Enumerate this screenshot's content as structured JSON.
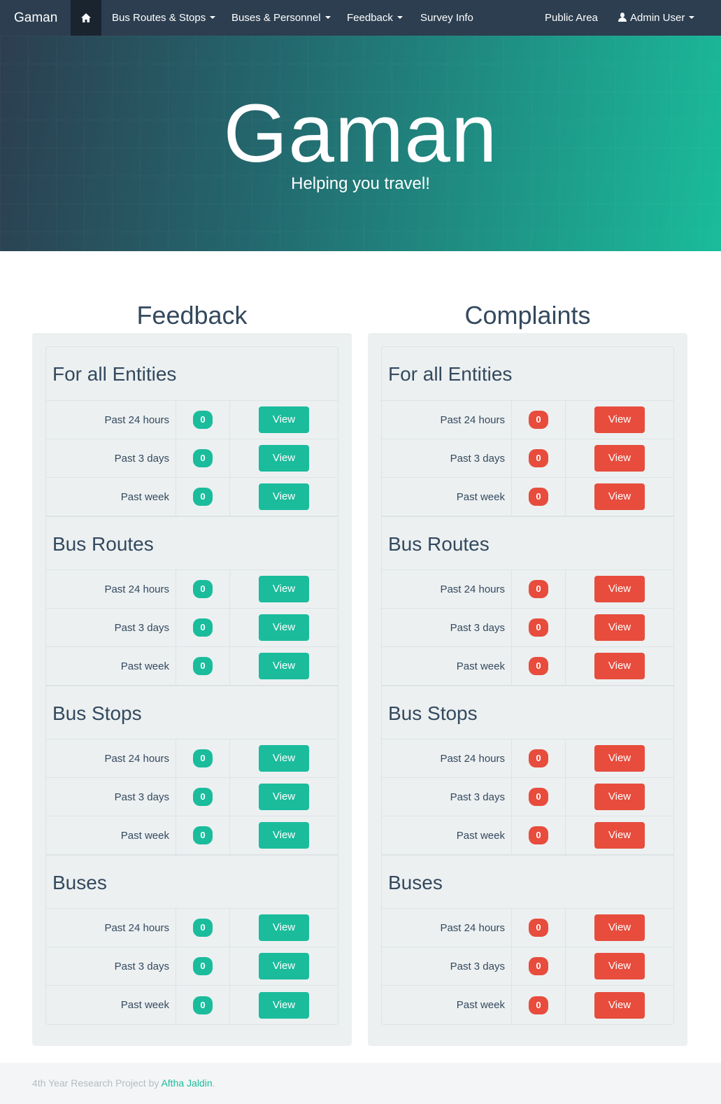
{
  "nav": {
    "brand": "Gaman",
    "items": [
      {
        "label": "Bus Routes & Stops",
        "dropdown": true
      },
      {
        "label": "Buses & Personnel",
        "dropdown": true
      },
      {
        "label": "Feedback",
        "dropdown": true
      },
      {
        "label": "Survey Info",
        "dropdown": false
      }
    ],
    "public_area": "Public Area",
    "user": "Admin User"
  },
  "hero": {
    "title": "Gaman",
    "subtitle": "Helping you travel!"
  },
  "columns": [
    {
      "title": "Feedback",
      "color": "#1abc9c",
      "sections": [
        {
          "heading": "For all Entities",
          "rows": [
            {
              "label": "Past 24 hours",
              "count": "0",
              "button": "View"
            },
            {
              "label": "Past 3 days",
              "count": "0",
              "button": "View"
            },
            {
              "label": "Past week",
              "count": "0",
              "button": "View"
            }
          ]
        },
        {
          "heading": "Bus Routes",
          "rows": [
            {
              "label": "Past 24 hours",
              "count": "0",
              "button": "View"
            },
            {
              "label": "Past 3 days",
              "count": "0",
              "button": "View"
            },
            {
              "label": "Past week",
              "count": "0",
              "button": "View"
            }
          ]
        },
        {
          "heading": "Bus Stops",
          "rows": [
            {
              "label": "Past 24 hours",
              "count": "0",
              "button": "View"
            },
            {
              "label": "Past 3 days",
              "count": "0",
              "button": "View"
            },
            {
              "label": "Past week",
              "count": "0",
              "button": "View"
            }
          ]
        },
        {
          "heading": "Buses",
          "rows": [
            {
              "label": "Past 24 hours",
              "count": "0",
              "button": "View"
            },
            {
              "label": "Past 3 days",
              "count": "0",
              "button": "View"
            },
            {
              "label": "Past week",
              "count": "0",
              "button": "View"
            }
          ]
        }
      ]
    },
    {
      "title": "Complaints",
      "color": "#e74c3c",
      "sections": [
        {
          "heading": "For all Entities",
          "rows": [
            {
              "label": "Past 24 hours",
              "count": "0",
              "button": "View"
            },
            {
              "label": "Past 3 days",
              "count": "0",
              "button": "View"
            },
            {
              "label": "Past week",
              "count": "0",
              "button": "View"
            }
          ]
        },
        {
          "heading": "Bus Routes",
          "rows": [
            {
              "label": "Past 24 hours",
              "count": "0",
              "button": "View"
            },
            {
              "label": "Past 3 days",
              "count": "0",
              "button": "View"
            },
            {
              "label": "Past week",
              "count": "0",
              "button": "View"
            }
          ]
        },
        {
          "heading": "Bus Stops",
          "rows": [
            {
              "label": "Past 24 hours",
              "count": "0",
              "button": "View"
            },
            {
              "label": "Past 3 days",
              "count": "0",
              "button": "View"
            },
            {
              "label": "Past week",
              "count": "0",
              "button": "View"
            }
          ]
        },
        {
          "heading": "Buses",
          "rows": [
            {
              "label": "Past 24 hours",
              "count": "0",
              "button": "View"
            },
            {
              "label": "Past 3 days",
              "count": "0",
              "button": "View"
            },
            {
              "label": "Past week",
              "count": "0",
              "button": "View"
            }
          ]
        }
      ]
    }
  ],
  "footer": {
    "text": "4th Year Research Project by ",
    "link": "Aftha Jaldin",
    "suffix": "."
  }
}
